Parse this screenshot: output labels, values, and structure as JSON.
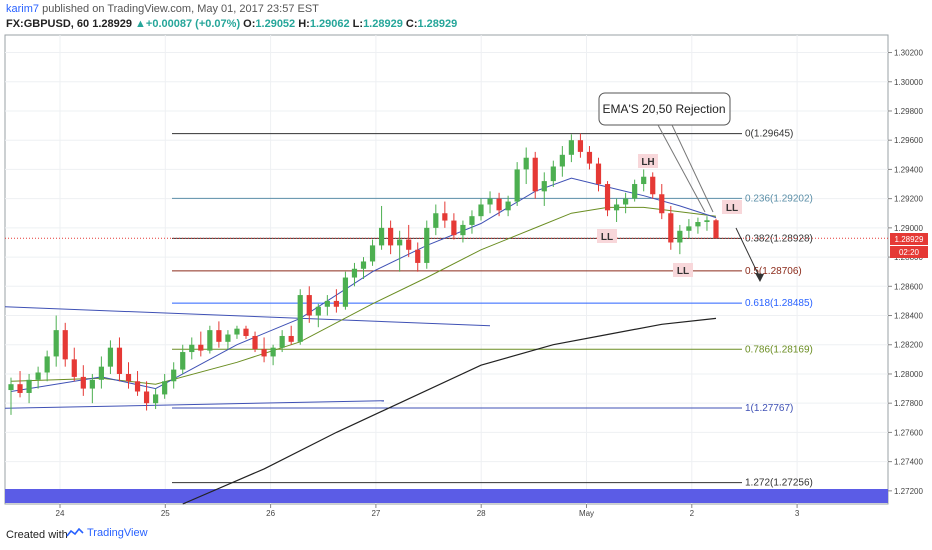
{
  "header": {
    "author": "karim7",
    "published": "published on TradingView.com, May 01, 2017 23:57 EST",
    "symbol": "FX:GBPUSD, 60",
    "last": "1.28929",
    "arrow": "▲",
    "change": "+0.00087 (+0.07%)",
    "o_label": "O:",
    "o": "1.29052",
    "h_label": "H:",
    "h": "1.29062",
    "l_label": "L:",
    "l": "1.28929",
    "c_label": "C:",
    "c": "1.28929"
  },
  "footer": {
    "created": "Created with",
    "brand": "TradingView"
  },
  "price_badge": {
    "price": "1.28929",
    "countdown": "02:20"
  },
  "annotations": {
    "callout": "EMA'S 20,50 Rejection",
    "lh": "LH",
    "ll1": "LL",
    "ll2": "LL",
    "ll3": "LL"
  },
  "colors": {
    "up": "#26a69a",
    "up_body": "#4caf50",
    "down": "#e53935",
    "ema20": "#3f51b5",
    "ema50": "#6b8e23",
    "ema200": "#222222",
    "channel": "#3f51b5",
    "band": "#5b5ce6"
  },
  "chart_data": {
    "type": "candlestick",
    "symbol": "GBPUSD",
    "timeframe": "60",
    "ylim": [
      1.2711,
      1.3032
    ],
    "y_ticks": [
      "1.30200",
      "1.30000",
      "1.29800",
      "1.29600",
      "1.29400",
      "1.29200",
      "1.29000",
      "1.28800",
      "1.28600",
      "1.28400",
      "1.28200",
      "1.28000",
      "1.27800",
      "1.27600",
      "1.27400",
      "1.27200"
    ],
    "x_ticks": [
      "24",
      "25",
      "26",
      "27",
      "28",
      "May",
      "2",
      "3"
    ],
    "fib_levels": [
      {
        "label": "0(1.29645)",
        "price": 1.29645,
        "color": "#333333"
      },
      {
        "label": "0.236(1.29202)",
        "price": 1.29202,
        "color": "#5b8fa8"
      },
      {
        "label": "0.382(1.28928)",
        "price": 1.28928,
        "color": "#333333"
      },
      {
        "label": "0.5(1.28706)",
        "price": 1.28706,
        "color": "#8b2a1a"
      },
      {
        "label": "0.618(1.28485)",
        "price": 1.28485,
        "color": "#2962ff"
      },
      {
        "label": "0.786(1.28169)",
        "price": 1.28169,
        "color": "#6b8e23"
      },
      {
        "label": "1(1.27767)",
        "price": 1.27767,
        "color": "#3f51b5"
      },
      {
        "label": "1.272(1.27256)",
        "price": 1.27256,
        "color": "#333333"
      }
    ],
    "last_price": 1.28929,
    "ohlc": [
      [
        1.2789,
        1.27975,
        1.2772,
        1.2793
      ],
      [
        1.2793,
        1.2802,
        1.2784,
        1.2787
      ],
      [
        1.2787,
        1.28,
        1.278,
        1.2796
      ],
      [
        1.2796,
        1.2805,
        1.279,
        1.2801
      ],
      [
        1.2801,
        1.2816,
        1.2795,
        1.2812
      ],
      [
        1.2812,
        1.284,
        1.2805,
        1.283
      ],
      [
        1.283,
        1.2835,
        1.2805,
        1.281
      ],
      [
        1.281,
        1.2818,
        1.2795,
        1.2798
      ],
      [
        1.2798,
        1.2806,
        1.2785,
        1.279
      ],
      [
        1.279,
        1.28,
        1.278,
        1.2796
      ],
      [
        1.2796,
        1.2812,
        1.279,
        1.2805
      ],
      [
        1.2805,
        1.2823,
        1.28,
        1.2818
      ],
      [
        1.2818,
        1.2825,
        1.2795,
        1.28
      ],
      [
        1.28,
        1.2808,
        1.279,
        1.2795
      ],
      [
        1.2795,
        1.2802,
        1.2785,
        1.2788
      ],
      [
        1.2788,
        1.2795,
        1.2775,
        1.278
      ],
      [
        1.278,
        1.279,
        1.2776,
        1.2786
      ],
      [
        1.2786,
        1.28,
        1.2783,
        1.2795
      ],
      [
        1.2795,
        1.2808,
        1.279,
        1.2803
      ],
      [
        1.2803,
        1.282,
        1.28,
        1.2815
      ],
      [
        1.2815,
        1.2825,
        1.281,
        1.282
      ],
      [
        1.282,
        1.2829,
        1.2812,
        1.2816
      ],
      [
        1.2816,
        1.2833,
        1.2814,
        1.283
      ],
      [
        1.283,
        1.2836,
        1.2818,
        1.2822
      ],
      [
        1.2822,
        1.283,
        1.2817,
        1.2827
      ],
      [
        1.2827,
        1.2833,
        1.2824,
        1.2831
      ],
      [
        1.2831,
        1.2833,
        1.2824,
        1.2826
      ],
      [
        1.2826,
        1.2829,
        1.2815,
        1.2817
      ],
      [
        1.2817,
        1.2825,
        1.2808,
        1.2812
      ],
      [
        1.2812,
        1.282,
        1.2806,
        1.2818
      ],
      [
        1.2818,
        1.283,
        1.2815,
        1.2826
      ],
      [
        1.2826,
        1.2833,
        1.282,
        1.2822
      ],
      [
        1.2822,
        1.2858,
        1.282,
        1.2854
      ],
      [
        1.2854,
        1.286,
        1.2835,
        1.284
      ],
      [
        1.284,
        1.2848,
        1.2832,
        1.2846
      ],
      [
        1.2846,
        1.2854,
        1.284,
        1.285
      ],
      [
        1.285,
        1.2858,
        1.2842,
        1.2846
      ],
      [
        1.2846,
        1.287,
        1.2844,
        1.2866
      ],
      [
        1.2866,
        1.2876,
        1.286,
        1.2872
      ],
      [
        1.2872,
        1.288,
        1.2865,
        1.2877
      ],
      [
        1.2877,
        1.2892,
        1.2874,
        1.2888
      ],
      [
        1.2888,
        1.2915,
        1.2885,
        1.29
      ],
      [
        1.29,
        1.2905,
        1.2882,
        1.2888
      ],
      [
        1.2888,
        1.2898,
        1.287,
        1.2892
      ],
      [
        1.2892,
        1.2902,
        1.288,
        1.2885
      ],
      [
        1.2885,
        1.289,
        1.287,
        1.2876
      ],
      [
        1.2876,
        1.2905,
        1.2872,
        1.29
      ],
      [
        1.29,
        1.2916,
        1.2895,
        1.291
      ],
      [
        1.291,
        1.2918,
        1.29,
        1.2905
      ],
      [
        1.2905,
        1.291,
        1.2892,
        1.2895
      ],
      [
        1.2895,
        1.2905,
        1.289,
        1.2902
      ],
      [
        1.2902,
        1.2912,
        1.2896,
        1.2908
      ],
      [
        1.2908,
        1.292,
        1.2905,
        1.2916
      ],
      [
        1.2916,
        1.2925,
        1.291,
        1.292
      ],
      [
        1.292,
        1.2924,
        1.2908,
        1.2912
      ],
      [
        1.2912,
        1.2922,
        1.2908,
        1.2918
      ],
      [
        1.2918,
        1.2945,
        1.2915,
        1.294
      ],
      [
        1.294,
        1.2955,
        1.293,
        1.2948
      ],
      [
        1.2948,
        1.2952,
        1.292,
        1.2925
      ],
      [
        1.2925,
        1.2938,
        1.2915,
        1.2932
      ],
      [
        1.2932,
        1.2946,
        1.2928,
        1.2942
      ],
      [
        1.2942,
        1.2956,
        1.2935,
        1.295
      ],
      [
        1.295,
        1.2964,
        1.2945,
        1.296
      ],
      [
        1.296,
        1.29645,
        1.2948,
        1.2952
      ],
      [
        1.2952,
        1.2956,
        1.294,
        1.2944
      ],
      [
        1.2944,
        1.2948,
        1.2925,
        1.293
      ],
      [
        1.293,
        1.2932,
        1.2908,
        1.2912
      ],
      [
        1.2912,
        1.292,
        1.2904,
        1.2916
      ],
      [
        1.2916,
        1.2924,
        1.291,
        1.292
      ],
      [
        1.292,
        1.2933,
        1.2918,
        1.293
      ],
      [
        1.293,
        1.294,
        1.2925,
        1.2935
      ],
      [
        1.2935,
        1.2938,
        1.292,
        1.2923
      ],
      [
        1.2923,
        1.293,
        1.2906,
        1.291
      ],
      [
        1.291,
        1.2915,
        1.2885,
        1.289
      ],
      [
        1.289,
        1.2902,
        1.2882,
        1.2898
      ],
      [
        1.2898,
        1.2906,
        1.2893,
        1.2901
      ],
      [
        1.2901,
        1.2907,
        1.2896,
        1.2904
      ],
      [
        1.2904,
        1.2908,
        1.2898,
        1.29052
      ],
      [
        1.29052,
        1.29062,
        1.28929,
        1.28929
      ]
    ],
    "ema20": [
      [
        0,
        1.2788
      ],
      [
        10,
        1.2798
      ],
      [
        16,
        1.279
      ],
      [
        25,
        1.282
      ],
      [
        32,
        1.2838
      ],
      [
        40,
        1.287
      ],
      [
        46,
        1.2888
      ],
      [
        52,
        1.2903
      ],
      [
        58,
        1.2925
      ],
      [
        62,
        1.2934
      ],
      [
        66,
        1.2928
      ],
      [
        70,
        1.2922
      ],
      [
        74,
        1.2915
      ],
      [
        78,
        1.2907
      ]
    ],
    "ema50": [
      [
        0,
        1.2795
      ],
      [
        10,
        1.2797
      ],
      [
        16,
        1.2793
      ],
      [
        25,
        1.2808
      ],
      [
        32,
        1.2822
      ],
      [
        40,
        1.2848
      ],
      [
        46,
        1.2866
      ],
      [
        52,
        1.2885
      ],
      [
        58,
        1.29
      ],
      [
        62,
        1.291
      ],
      [
        66,
        1.2914
      ],
      [
        70,
        1.2914
      ],
      [
        74,
        1.2911
      ],
      [
        78,
        1.2908
      ]
    ],
    "ema200": [
      [
        19,
        1.2711
      ],
      [
        28,
        1.2735
      ],
      [
        36,
        1.276
      ],
      [
        44,
        1.2783
      ],
      [
        52,
        1.2806
      ],
      [
        60,
        1.282
      ],
      [
        66,
        1.2827
      ],
      [
        72,
        1.2834
      ],
      [
        78,
        1.2838
      ]
    ]
  }
}
